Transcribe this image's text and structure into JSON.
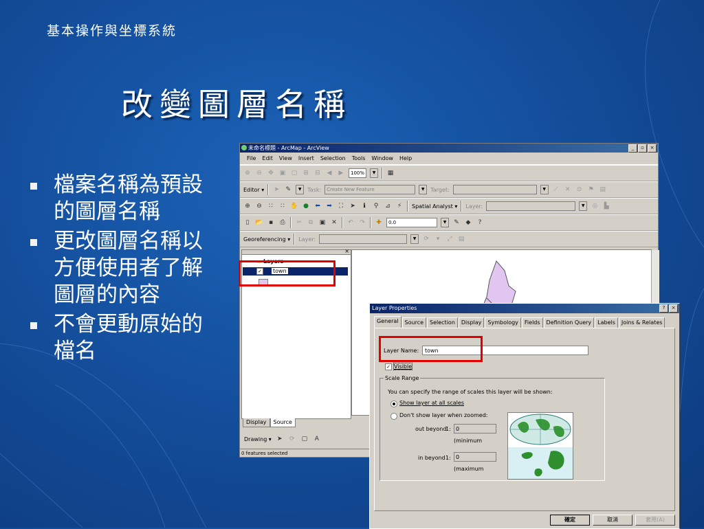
{
  "slide": {
    "header": "基本操作與坐標系統",
    "title": "改變圖層名稱",
    "bullets": [
      "檔案名稱為預設的圖層名稱",
      "更改圖層名稱以方便使用者了解圖層的內容",
      "不會更動原始的檔名"
    ]
  },
  "arcmap": {
    "title": "未命名標題 - ArcMap - ArcView",
    "menu": [
      "File",
      "Edit",
      "View",
      "Insert",
      "Selection",
      "Tools",
      "Window",
      "Help"
    ],
    "scale_value": "100%",
    "editor_label": "Editor ▾",
    "task_label": "Task:",
    "task_value": "Create New Feature",
    "target_label": "Target:",
    "spatial_analyst_label": "Spatial Analyst ▾",
    "layer_label": "Layer:",
    "coord_value": "0.0",
    "georef_label": "Georeferencing ▾",
    "toc": {
      "root": "Layers",
      "layer_name": "town",
      "tabs": [
        "Display",
        "Source"
      ]
    },
    "drawing_label": "Drawing ▾",
    "status": "0 features selected"
  },
  "dialog": {
    "title": "Layer Properties",
    "tabs": [
      "General",
      "Source",
      "Selection",
      "Display",
      "Symbology",
      "Fields",
      "Definition Query",
      "Labels",
      "Joins & Relates"
    ],
    "layer_name_label": "Layer Name:",
    "layer_name_value": "town",
    "visible_label": "Visible",
    "scale_range_label": "Scale Range",
    "scale_hint": "You can specify the range of scales this layer will be shown:",
    "radio_all": "Show layer at all scales",
    "radio_zoom": "Don't show layer when zoomed:",
    "out_beyond": "out beyond",
    "in_beyond": "in beyond",
    "ratio_prefix": "1:",
    "out_value": "0",
    "in_value": "0",
    "min_note": "(minimum",
    "max_note": "(maximum",
    "ok": "確定",
    "cancel": "取消",
    "apply": "套用(A)"
  },
  "colors": {
    "background": "#144f9d",
    "highlight": "#e00000",
    "polygon": "#e2c6f2"
  }
}
